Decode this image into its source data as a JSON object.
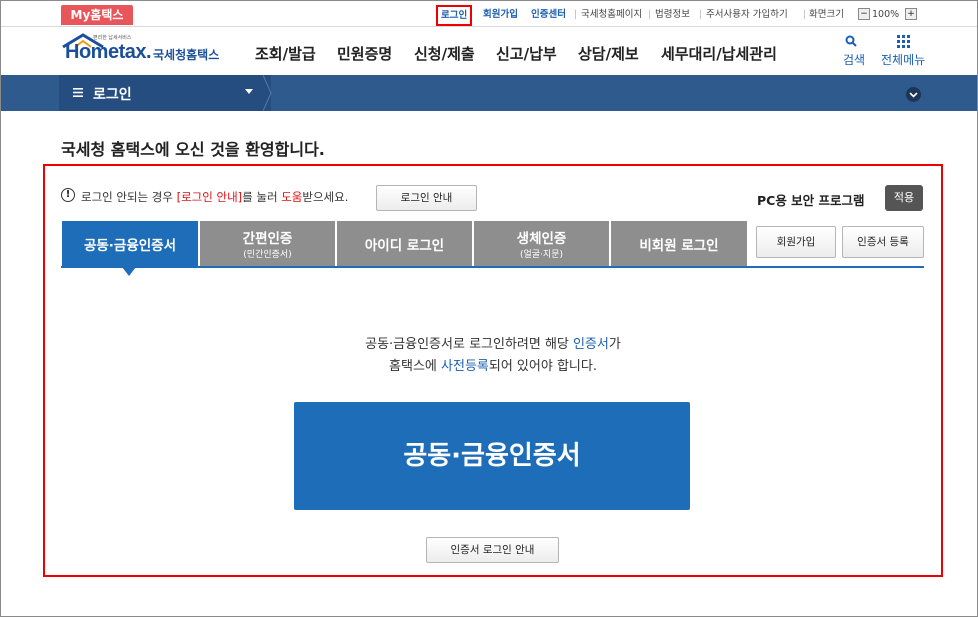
{
  "top": {
    "my_hometax": "My홈택스",
    "login": "로그인",
    "signup": "회원가입",
    "cert_center": "인증센터",
    "nts_home": "국세청홈페이지",
    "law_info": "법령정보",
    "cmd_user_join": "주서사용자 가입하기",
    "screen_size": "화면크기",
    "zoom_minus": "−",
    "zoom_value": "100%",
    "zoom_plus": "+"
  },
  "header": {
    "logo_tiny": "편리한 납세서비스",
    "logo_main": "Hometax.",
    "logo_kr": "국세청홈택스",
    "nav": [
      "조회/발급",
      "민원증명",
      "신청/제출",
      "신고/납부",
      "상담/제보",
      "세무대리/납세관리"
    ],
    "search": "검색",
    "all_menu": "전체메뉴"
  },
  "breadcrumb": {
    "label": "로그인"
  },
  "page": {
    "welcome": "국세청 홈택스에 오신 것을 환영합니다.",
    "info_a": "로그인 안되는 경우 ",
    "info_b": "[로그인 안내]",
    "info_c": "를 눌러 ",
    "info_d": "도움",
    "info_e": "받으세요.",
    "login_guide_btn": "로그인 안내",
    "pc_security": "PC용 보안 프로그램",
    "apply_btn": "적용"
  },
  "tabs": [
    {
      "label": "공동·금융인증서",
      "sub": ""
    },
    {
      "label": "간편인증",
      "sub": "(민간인증서)"
    },
    {
      "label": "아이디 로그인",
      "sub": ""
    },
    {
      "label": "생체인증",
      "sub": "(얼굴·지문)"
    },
    {
      "label": "비회원 로그인",
      "sub": ""
    }
  ],
  "side_buttons": {
    "signup": "회원가입",
    "cert_register": "인증서 등록"
  },
  "content": {
    "desc1_a": "공동·금융인증서로 로그인하려면 해당 ",
    "desc1_b": "인증서",
    "desc1_c": "가",
    "desc2_a": "홈택스에 ",
    "desc2_b": "사전등록",
    "desc2_c": "되어 있어야 합니다.",
    "main_button": "공동·금융인증서",
    "cert_guide_btn": "인증서 로그인 안내"
  },
  "colors": {
    "accent": "#1e6db8",
    "bar": "#2f5a8e",
    "highlight": "#e00000"
  }
}
